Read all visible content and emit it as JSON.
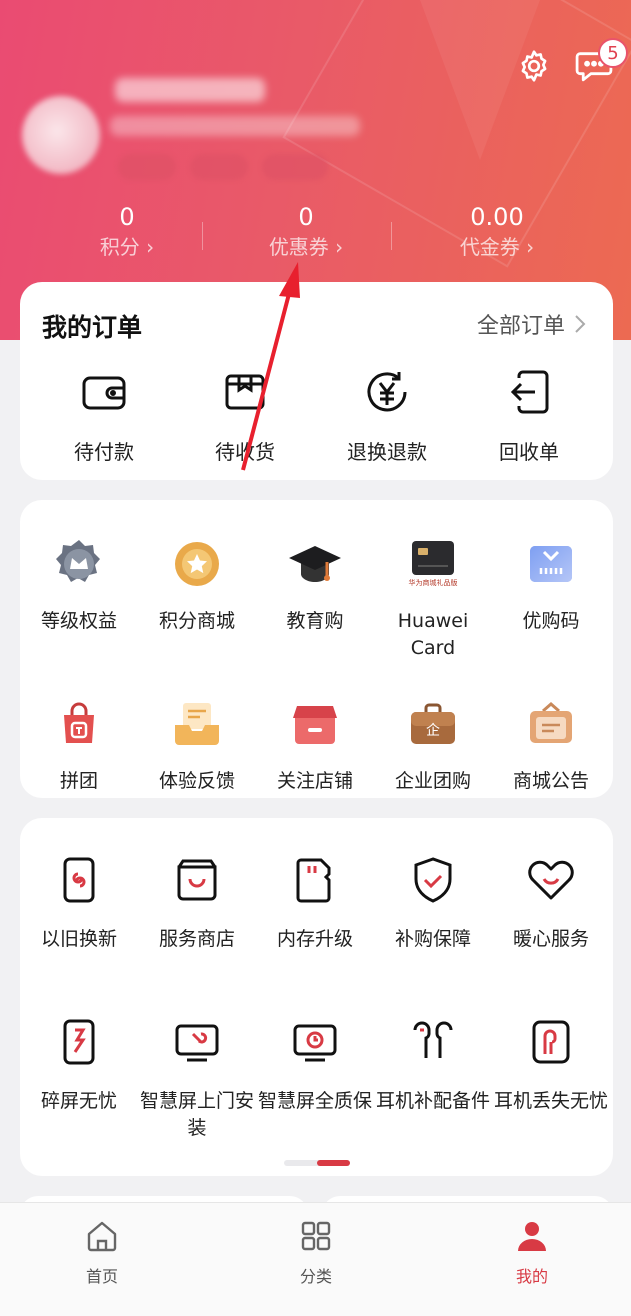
{
  "header": {
    "messages_badge": "5",
    "stats": [
      {
        "value": "0",
        "label": "积分 ›"
      },
      {
        "value": "0",
        "label": "优惠券 ›"
      },
      {
        "value": "0.00",
        "label": "代金券 ›"
      }
    ]
  },
  "orders": {
    "title": "我的订单",
    "all_label": "全部订单",
    "items": [
      {
        "label": "待付款",
        "icon": "wallet-icon"
      },
      {
        "label": "待收货",
        "icon": "package-icon"
      },
      {
        "label": "退换退款",
        "icon": "yen-refund-icon"
      },
      {
        "label": "回收单",
        "icon": "recycle-in-icon"
      }
    ]
  },
  "services1": [
    {
      "label": "等级权益",
      "icon": "crown-badge-icon"
    },
    {
      "label": "积分商城",
      "icon": "star-coin-icon"
    },
    {
      "label": "教育购",
      "icon": "graduation-cap-icon"
    },
    {
      "label": "Huawei Card",
      "icon": "gift-card-icon",
      "card_caption": "华为商城礼品版"
    },
    {
      "label": "优购码",
      "icon": "coupon-code-icon"
    },
    {
      "label": "拼团",
      "icon": "group-bag-icon"
    },
    {
      "label": "体验反馈",
      "icon": "feedback-tray-icon"
    },
    {
      "label": "关注店铺",
      "icon": "store-icon"
    },
    {
      "label": "企业团购",
      "icon": "briefcase-icon"
    },
    {
      "label": "商城公告",
      "icon": "notice-bag-icon"
    }
  ],
  "services2": [
    {
      "label": "以旧换新",
      "icon": "trade-in-phone-icon"
    },
    {
      "label": "服务商店",
      "icon": "service-store-icon"
    },
    {
      "label": "内存升级",
      "icon": "sd-card-icon"
    },
    {
      "label": "补购保障",
      "icon": "shield-check-icon"
    },
    {
      "label": "暖心服务",
      "icon": "heart-smile-icon"
    },
    {
      "label": "碎屏无忧",
      "icon": "broken-screen-icon"
    },
    {
      "label": "智慧屏上门安装",
      "icon": "tv-install-icon"
    },
    {
      "label": "智慧屏全质保",
      "icon": "tv-warranty-icon"
    },
    {
      "label": "耳机补配备件",
      "icon": "earbuds-icon"
    },
    {
      "label": "耳机丢失无忧",
      "icon": "earbud-lost-icon"
    }
  ],
  "tabbar": [
    {
      "label": "首页",
      "icon": "home-icon"
    },
    {
      "label": "分类",
      "icon": "category-grid-icon"
    },
    {
      "label": "我的",
      "icon": "person-icon"
    }
  ],
  "colors": {
    "accent": "#d83a44",
    "header_start": "#ea4b72",
    "header_end": "#ec6a52"
  }
}
